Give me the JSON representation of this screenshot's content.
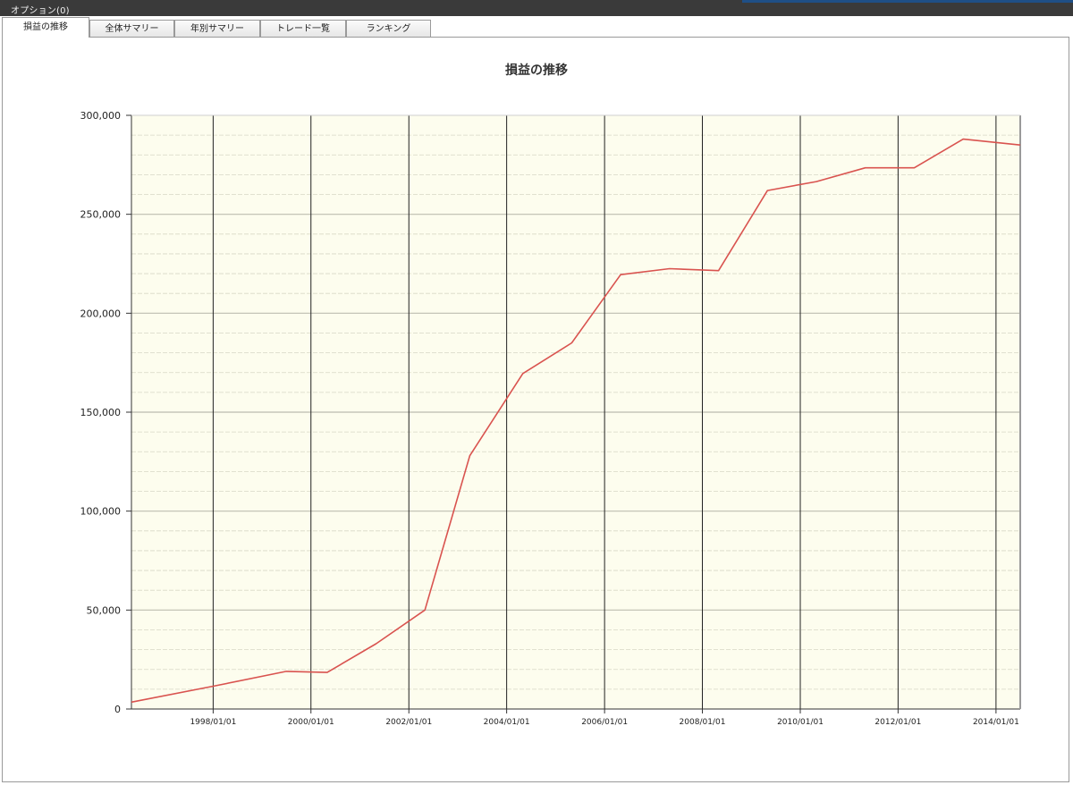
{
  "window": {
    "title": "オプション(0)"
  },
  "tabs": [
    {
      "label": "損益の推移",
      "active": true
    },
    {
      "label": "全体サマリー",
      "active": false
    },
    {
      "label": "年別サマリー",
      "active": false
    },
    {
      "label": "トレード一覧",
      "active": false
    },
    {
      "label": "ランキング",
      "active": false
    }
  ],
  "colors": {
    "plot_background": "#fdfdee",
    "line": "#d9534f",
    "major_grid": "#bdbdb0",
    "minor_grid": "#d8d8c6",
    "vertical_grid": "#222222"
  },
  "chart_data": {
    "type": "line",
    "title": "損益の推移",
    "xlabel": "",
    "ylabel": "",
    "ylim": [
      0,
      300000
    ],
    "yticks": [
      0,
      50000,
      100000,
      150000,
      200000,
      250000,
      300000
    ],
    "ytick_labels": [
      "0",
      "50,000",
      "100,000",
      "150,000",
      "200,000",
      "250,000",
      "300,000"
    ],
    "xlim": [
      "1996/05/01",
      "2014/07/01"
    ],
    "xticks": [
      "1998/01/01",
      "2000/01/01",
      "2002/01/01",
      "2004/01/01",
      "2006/01/01",
      "2008/01/01",
      "2010/01/01",
      "2012/01/01",
      "2014/01/01"
    ],
    "grid": true,
    "series": [
      {
        "points": [
          [
            "1996/05/01",
            3500
          ],
          [
            "1998/01/01",
            11500
          ],
          [
            "1999/07/01",
            19000
          ],
          [
            "2000/05/01",
            18500
          ],
          [
            "2001/05/01",
            33000
          ],
          [
            "2002/05/01",
            50000
          ],
          [
            "2003/04/01",
            128000
          ],
          [
            "2004/05/01",
            169500
          ],
          [
            "2005/05/01",
            185000
          ],
          [
            "2006/05/01",
            219500
          ],
          [
            "2007/05/01",
            222500
          ],
          [
            "2008/05/01",
            221500
          ],
          [
            "2009/05/01",
            262000
          ],
          [
            "2010/05/01",
            266500
          ],
          [
            "2011/05/01",
            273500
          ],
          [
            "2012/05/01",
            273500
          ],
          [
            "2013/05/01",
            288000
          ],
          [
            "2014/07/01",
            285000
          ]
        ]
      }
    ]
  }
}
